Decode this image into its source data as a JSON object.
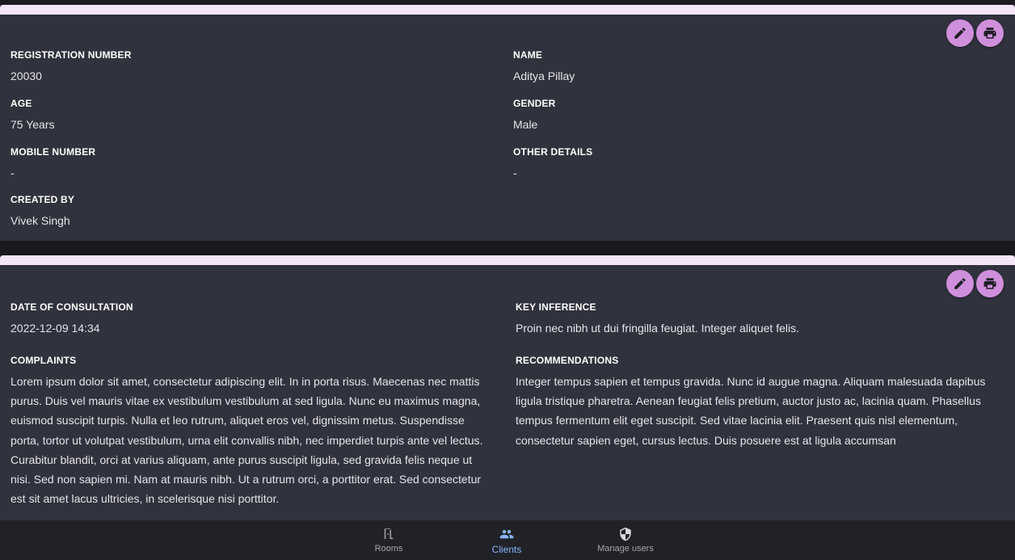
{
  "patient_card": {
    "edit_label": "edit",
    "print_label": "print",
    "fields": [
      {
        "label": "REGISTRATION NUMBER",
        "value": "20030"
      },
      {
        "label": "NAME",
        "value": "Aditya Pillay"
      },
      {
        "label": "AGE",
        "value": "75 Years"
      },
      {
        "label": "GENDER",
        "value": "Male"
      },
      {
        "label": "MOBILE NUMBER",
        "value": "-"
      },
      {
        "label": "OTHER DETAILS",
        "value": "-"
      },
      {
        "label": "CREATED BY",
        "value": "Vivek Singh"
      }
    ]
  },
  "consultation_card": {
    "date_label": "DATE OF CONSULTATION",
    "date_value": "2022-12-09 14:34",
    "key_inference_label": "KEY INFERENCE",
    "key_inference_value": "Proin nec nibh ut dui fringilla feugiat. Integer aliquet felis.",
    "complaints_label": "COMPLAINTS",
    "complaints_value": "Lorem ipsum dolor sit amet, consectetur adipiscing elit. In in porta risus. Maecenas nec mattis purus. Duis vel mauris vitae ex vestibulum vestibulum at sed ligula. Nunc eu maximus magna, euismod suscipit turpis. Nulla et leo rutrum, aliquet eros vel, dignissim metus. Suspendisse porta, tortor ut volutpat vestibulum, urna elit convallis nibh, nec imperdiet turpis ante vel lectus. Curabitur blandit, orci at varius aliquam, ante purus suscipit ligula, sed gravida felis neque ut nisi. Sed non sapien mi. Nam at mauris nibh. Ut a rutrum orci, a porttitor erat. Sed consectetur est sit amet lacus ultricies, in scelerisque nisi porttitor.",
    "recommendations_label": "RECOMMENDATIONS",
    "recommendations_value": "Integer tempus sapien et tempus gravida. Nunc id augue magna. Aliquam malesuada dapibus ligula tristique pharetra. Aenean feugiat felis pretium, auctor justo ac, lacinia quam. Phasellus tempus fermentum elit eget suscipit. Sed vitae lacinia elit. Praesent quis nisl elementum, consectetur sapien eget, cursus lectus. Duis posuere est at ligula accumsan"
  },
  "bottom_nav": {
    "items": [
      {
        "label": "Rooms",
        "icon": "door-icon",
        "active": false
      },
      {
        "label": "Clients",
        "icon": "people-icon",
        "active": true
      },
      {
        "label": "Manage users",
        "icon": "shield-icon",
        "active": false
      }
    ]
  },
  "colors": {
    "accent": "#d08fdc",
    "card_bg": "#30323d",
    "card_stripe": "#f6e4f8",
    "nav_active": "#8ab4f8"
  }
}
